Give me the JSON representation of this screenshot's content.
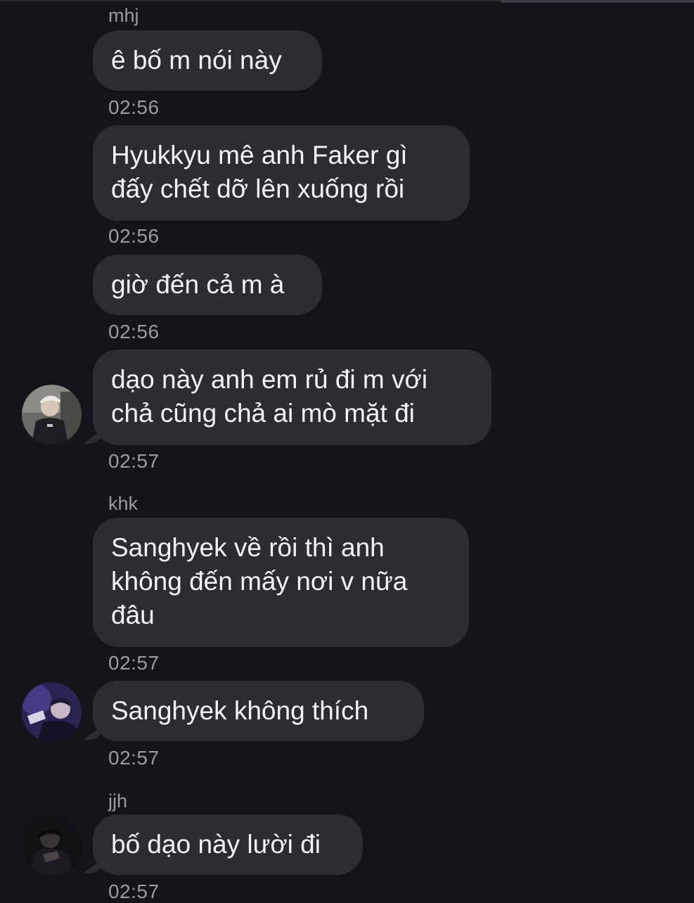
{
  "messages": [
    {
      "sender": "mhj",
      "text": "ê bố m nói này",
      "time": "02:56"
    },
    {
      "text": "Hyukkyu mê anh Faker gì\nđấy chết dỡ lên xuống rồi",
      "time": "02:56"
    },
    {
      "text": "giờ đến cả m à",
      "time": "02:56"
    },
    {
      "text": "dạo này anh em rủ đi m với\nchả cũng chả ai mò mặt đi",
      "time": "02:57",
      "avatar": "user-avatar-mhj"
    },
    {
      "sender": "khk",
      "text": "Sanghyek về rồi thì anh\nkhông đến mấy nơi v nữa\nđâu",
      "time": "02:57"
    },
    {
      "text": "Sanghyek không thích",
      "time": "02:57",
      "avatar": "user-avatar-khk"
    },
    {
      "sender": "jjh",
      "text": "bố dạo này lười đi",
      "time": "02:57",
      "avatar": "user-avatar-jjh"
    }
  ],
  "colors": {
    "background": "#16131a",
    "bubble": "#2d2c33",
    "text": "#f4f4f6",
    "meta": "#9c9aa3"
  }
}
